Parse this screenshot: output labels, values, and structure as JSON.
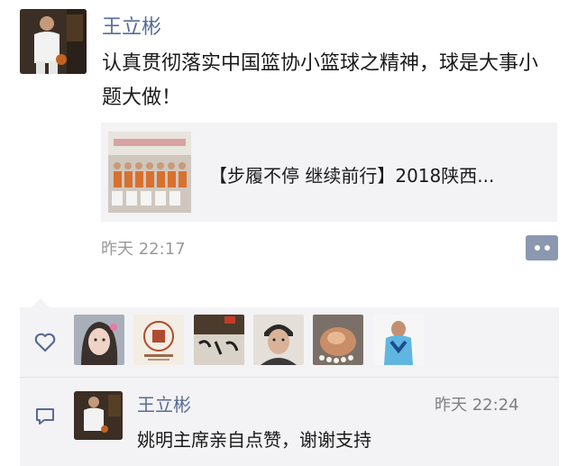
{
  "post": {
    "author": "王立彬",
    "text": "认真贯彻落实中国篮协小篮球之精神，球是大事小题大做！",
    "link": {
      "title": "【步履不停 继续前行】2018陕西..."
    },
    "time": "昨天 22:17"
  },
  "likes": {
    "icon": "heart-icon",
    "liker_count": 6
  },
  "comments": [
    {
      "author": "王立彬",
      "time": "昨天 22:24",
      "text": "姚明主席亲自点赞，谢谢支持"
    }
  ],
  "colors": {
    "accent": "#576b95",
    "panel": "#f3f3f5",
    "more_button": "#8b98b1"
  }
}
